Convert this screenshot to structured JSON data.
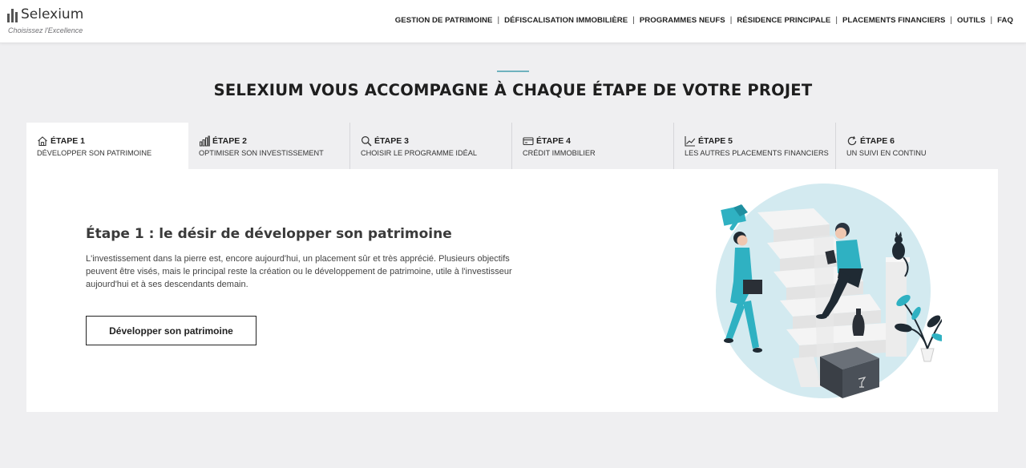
{
  "brand": {
    "name": "Selexium",
    "tagline": "Choisissez l'Excellence"
  },
  "nav": {
    "items": [
      "GESTION DE PATRIMOINE",
      "DÉFISCALISATION IMMOBILIÈRE",
      "PROGRAMMES NEUFS",
      "RÉSIDENCE PRINCIPALE",
      "PLACEMENTS FINANCIERS",
      "OUTILS",
      "FAQ"
    ],
    "separator": "|"
  },
  "section": {
    "title": "SELEXIUM VOUS ACCOMPAGNE À CHAQUE ÉTAPE DE VOTRE PROJET"
  },
  "tabs": [
    {
      "step": "ÉTAPE 1",
      "subtitle": "DÉVELOPPER SON PATRIMOINE",
      "icon": "house-icon",
      "active": true
    },
    {
      "step": "ÉTAPE 2",
      "subtitle": "OPTIMISER SON INVESTISSEMENT",
      "icon": "bar-chart-icon",
      "active": false
    },
    {
      "step": "ÉTAPE 3",
      "subtitle": "CHOISIR LE PROGRAMME IDÉAL",
      "icon": "magnifier-icon",
      "active": false
    },
    {
      "step": "ÉTAPE 4",
      "subtitle": "CRÉDIT IMMOBILIER",
      "icon": "credit-card-icon",
      "active": false
    },
    {
      "step": "ÉTAPE 5",
      "subtitle": "LES AUTRES PLACEMENTS FINANCIERS",
      "icon": "line-chart-icon",
      "active": false
    },
    {
      "step": "ÉTAPE 6",
      "subtitle": "UN SUIVI EN CONTINU",
      "icon": "refresh-icon",
      "active": false
    }
  ],
  "panel": {
    "title": "Étape 1 : le désir de développer son patrimoine",
    "text": "L'investissement dans la pierre est, encore aujourd'hui, un placement sûr et très apprécié. Plusieurs objectifs peuvent être visés, mais le principal reste la création ou le développement de patrimoine, utile à l'investisseur aujourd'hui et à ses descendants demain.",
    "cta_label": "Développer son patrimoine"
  },
  "colors": {
    "accent": "#6fb2be",
    "illustration_teal": "#2fb1c2",
    "illustration_bg": "#d3eaf0",
    "page_bg": "#efeff1"
  }
}
